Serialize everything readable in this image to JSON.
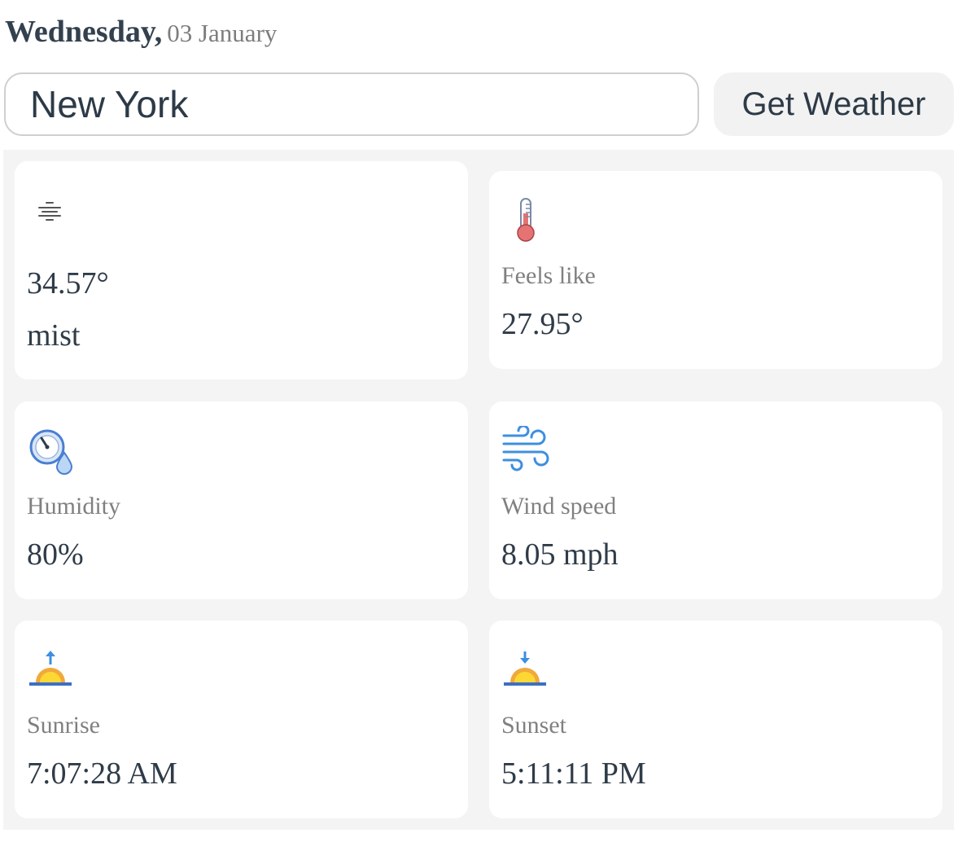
{
  "header": {
    "day": "Wednesday,",
    "date": "03 January"
  },
  "search": {
    "value": "New York",
    "button_label": "Get Weather"
  },
  "cards": {
    "current": {
      "icon": "mist-icon",
      "temperature": "34.57°",
      "description": "mist"
    },
    "feels_like": {
      "icon": "thermometer-icon",
      "label": "Feels like",
      "value": "27.95°"
    },
    "humidity": {
      "icon": "humidity-gauge-icon",
      "label": "Humidity",
      "value": "80%"
    },
    "wind": {
      "icon": "wind-icon",
      "label": "Wind speed",
      "value": "8.05 mph"
    },
    "sunrise": {
      "icon": "sunrise-icon",
      "label": "Sunrise",
      "value": "7:07:28 AM"
    },
    "sunset": {
      "icon": "sunset-icon",
      "label": "Sunset",
      "value": "5:11:11 PM"
    }
  },
  "colors": {
    "text_dark": "#2f3b48",
    "text_muted": "#808080",
    "panel_bg": "#f4f4f4",
    "card_bg": "#ffffff",
    "button_bg": "#f2f2f2",
    "icon_blue": "#3d8fe0",
    "thermometer_red": "#e57373",
    "sun_yellow": "#fdd835",
    "sun_orange": "#f0a93b"
  }
}
